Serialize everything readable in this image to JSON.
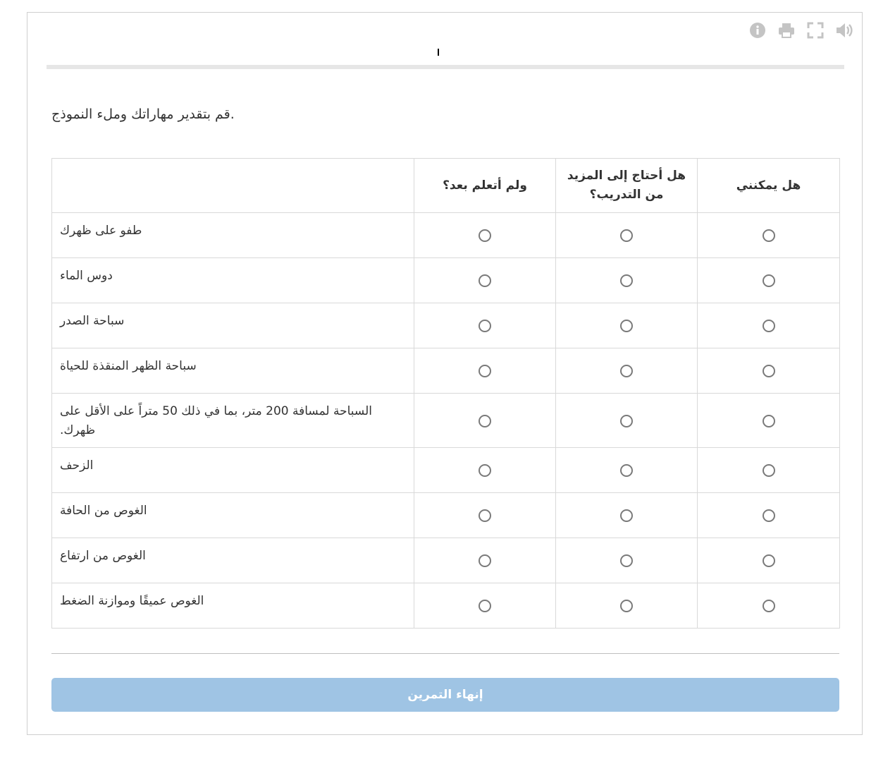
{
  "toolbar": {
    "icons": [
      "info-icon",
      "print-icon",
      "fullscreen-icon",
      "volume-icon"
    ],
    "icon_color": "#c4c4c4"
  },
  "progress": {
    "track_color": "#e6e6e6"
  },
  "intro": {
    "text": "قم بتقدير مهاراتك وملء النموذج."
  },
  "columns": {
    "not_yet": "ولم أتعلم بعد؟",
    "need_more": "هل أحتاج إلى المزيد من التدريب؟",
    "can_do": "هل يمكنني"
  },
  "rows": [
    "طفو على ظهرك",
    "دوس الماء",
    "سباحة الصدر",
    "سباحة الظهر المنقذة للحياة",
    "السباحة لمسافة 200 متر، بما في ذلك 50 متراً على الأقل على ظهرك.",
    "الزحف",
    "الغوص من الحافة",
    "الغوص من ارتفاع",
    "الغوص عميقًا وموازنة الضغط"
  ],
  "finish_button": {
    "label": "إنهاء التمرين",
    "color": "#9fc4e4"
  }
}
